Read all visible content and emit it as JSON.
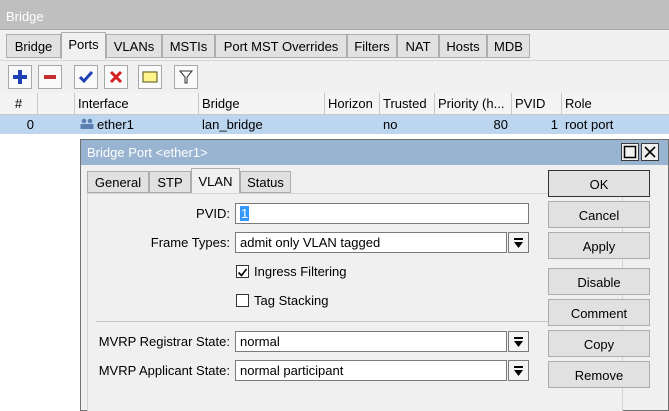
{
  "window": {
    "title": "Bridge"
  },
  "tabs": [
    {
      "label": "Bridge"
    },
    {
      "label": "Ports"
    },
    {
      "label": "VLANs"
    },
    {
      "label": "MSTIs"
    },
    {
      "label": "Port MST Overrides"
    },
    {
      "label": "Filters"
    },
    {
      "label": "NAT"
    },
    {
      "label": "Hosts"
    },
    {
      "label": "MDB"
    }
  ],
  "toolbar": {
    "icons": [
      "add-icon",
      "remove-icon",
      "enable-icon",
      "disable-icon",
      "comment-icon",
      "filter-icon"
    ]
  },
  "table": {
    "columns": [
      "#",
      "",
      "Interface",
      "Bridge",
      "Horizon",
      "Trusted",
      "Priority (h...",
      "PVID",
      "Role"
    ],
    "rows": [
      {
        "num": "0",
        "flag": "",
        "interface": "ether1",
        "bridge": "lan_bridge",
        "horizon": "",
        "trusted": "no",
        "priority": "80",
        "pvid": "1",
        "role": "root port"
      }
    ]
  },
  "dialog": {
    "title": "Bridge Port <ether1>",
    "tabs": [
      {
        "label": "General"
      },
      {
        "label": "STP"
      },
      {
        "label": "VLAN"
      },
      {
        "label": "Status"
      }
    ],
    "fields": {
      "pvid_label": "PVID:",
      "pvid_value": "1",
      "frame_types_label": "Frame Types:",
      "frame_types_value": "admit only VLAN tagged",
      "ingress_filtering_label": "Ingress Filtering",
      "ingress_filtering_checked": true,
      "tag_stacking_label": "Tag Stacking",
      "tag_stacking_checked": false,
      "mvrp_registrar_label": "MVRP Registrar State:",
      "mvrp_registrar_value": "normal",
      "mvrp_applicant_label": "MVRP Applicant State:",
      "mvrp_applicant_value": "normal participant"
    },
    "buttons": {
      "ok": "OK",
      "cancel": "Cancel",
      "apply": "Apply",
      "disable": "Disable",
      "comment": "Comment",
      "copy": "Copy",
      "remove": "Remove"
    }
  },
  "colors": {
    "selection": "#bcd6f0",
    "dialog_title": "#99b4d1",
    "add_icon": "#1f3fb5",
    "remove_icon": "#c43030"
  }
}
